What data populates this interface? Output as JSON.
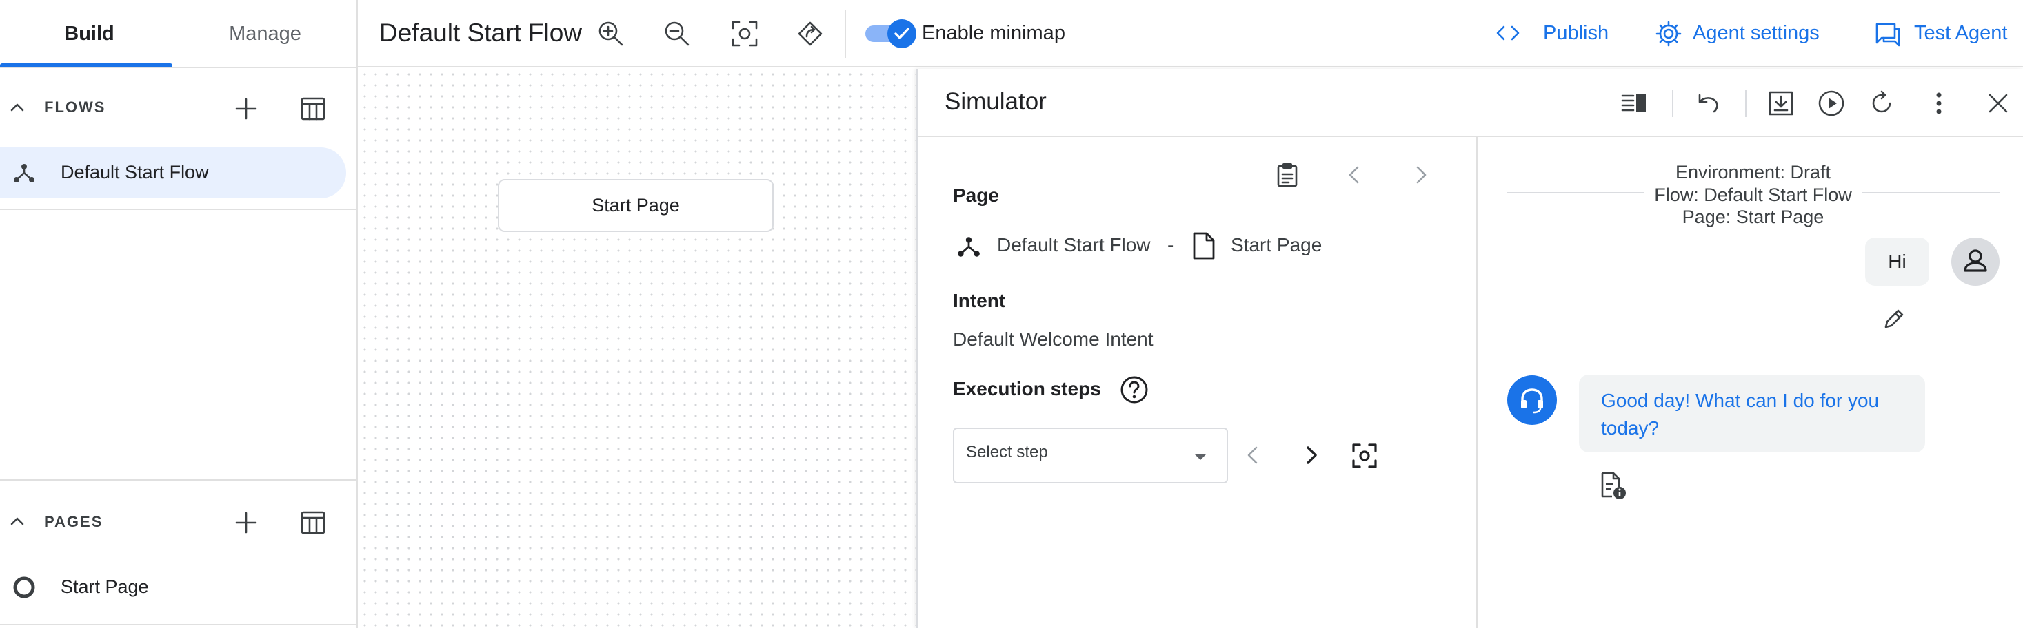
{
  "sidebar": {
    "tabs": [
      "Build",
      "Manage"
    ],
    "flows_title": "FLOWS",
    "flows": [
      "Default Start Flow"
    ],
    "pages_title": "PAGES",
    "pages": [
      "Start Page"
    ]
  },
  "header": {
    "title": "Default Start Flow",
    "minimap_label": "Enable minimap",
    "minimap_enabled": true,
    "publish": "Publish",
    "agent_settings": "Agent settings",
    "test_agent": "Test Agent"
  },
  "canvas": {
    "node_label": "Start Page"
  },
  "simulator": {
    "title": "Simulator",
    "page_label": "Page",
    "page_flow": "Default Start Flow",
    "page_sep": "-",
    "page_name": "Start Page",
    "intent_label": "Intent",
    "intent_value": "Default Welcome Intent",
    "steps_label": "Execution steps",
    "select_placeholder": "Select step",
    "chat": {
      "environment": "Environment: Draft",
      "flow": "Flow: Default Start Flow",
      "page": "Page: Start Page",
      "user_message": "Hi",
      "agent_message": "Good day! What can I do for you today?"
    }
  },
  "colors": {
    "accent": "#1a73e8",
    "selected_bg": "#e8f0fe",
    "bubble_bg": "#f1f3f4"
  }
}
